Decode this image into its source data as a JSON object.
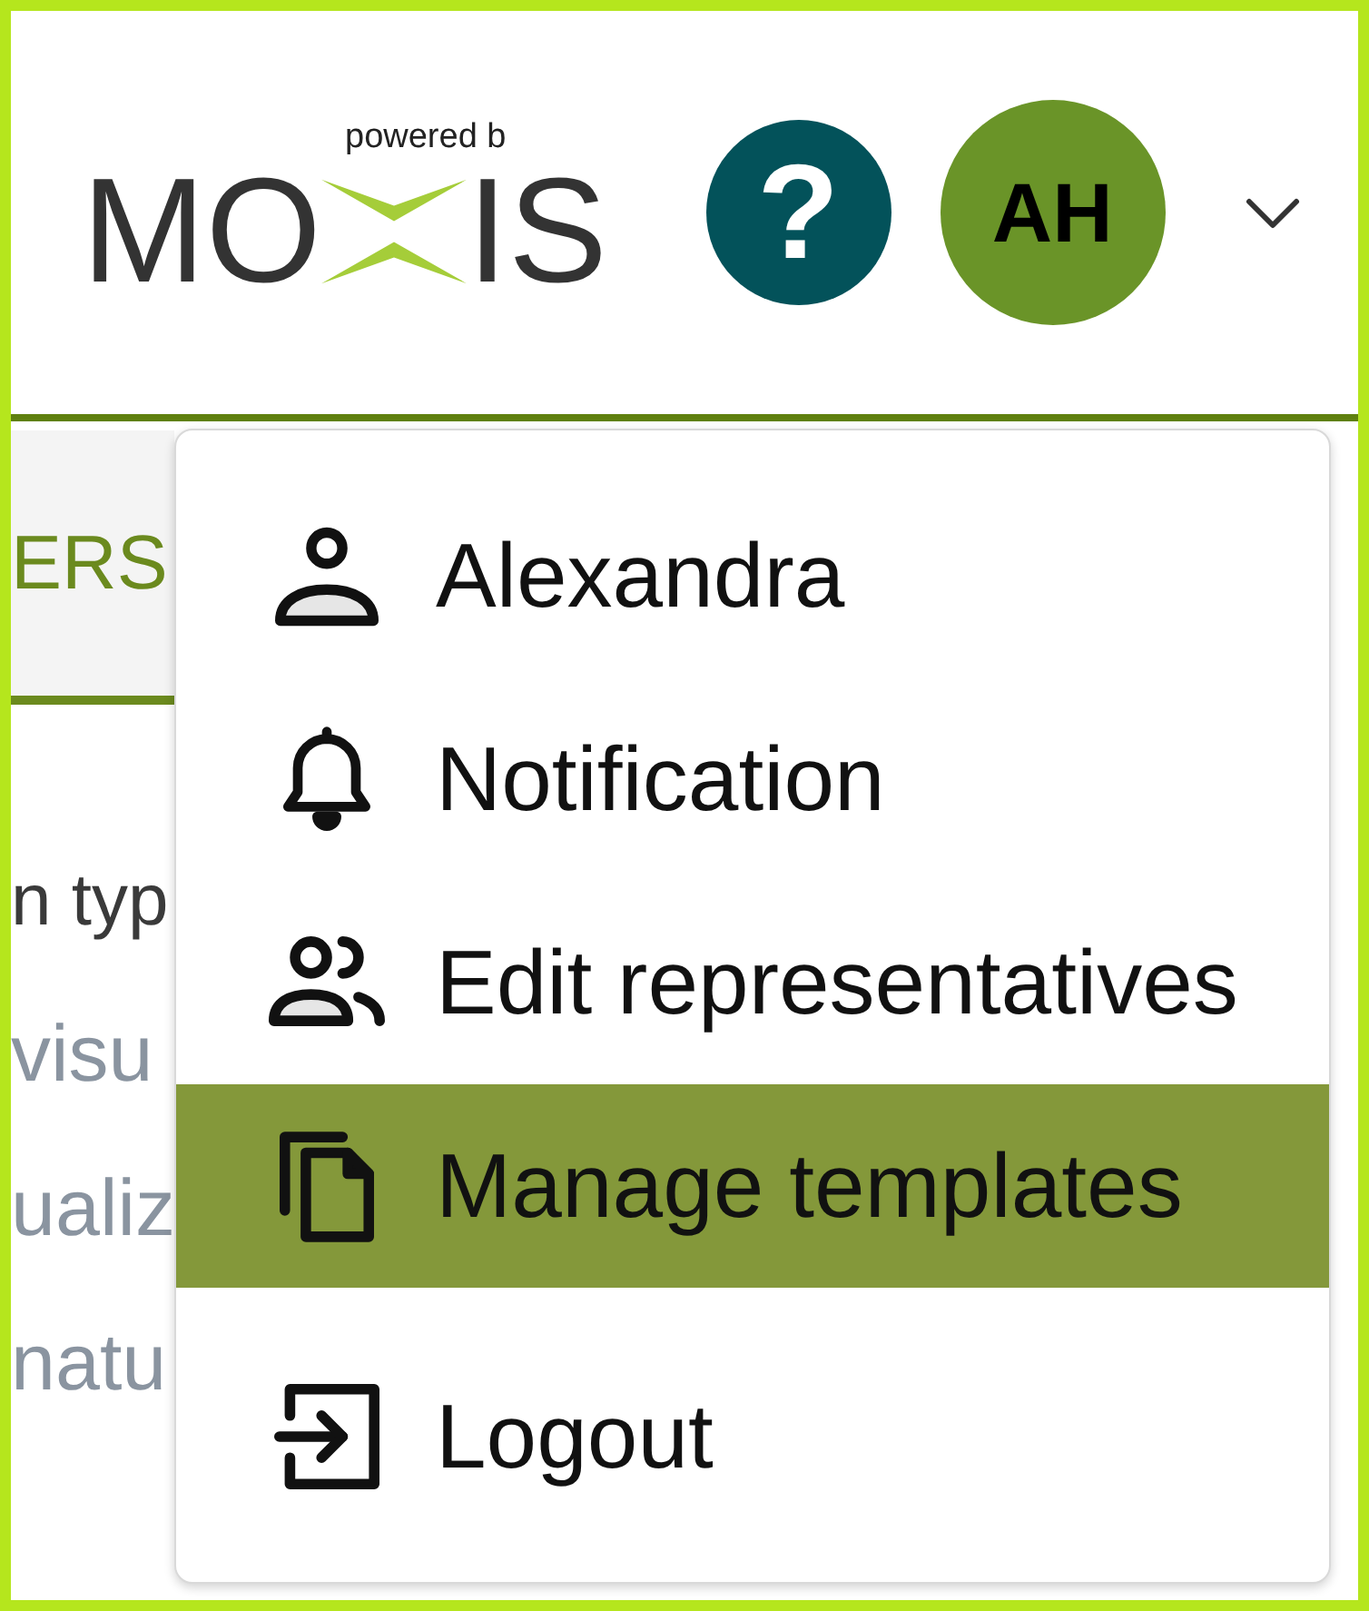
{
  "header": {
    "logo": {
      "tagline": "powered b",
      "wordmark_start": "MO",
      "wordmark_end": "IS"
    },
    "help_button": {
      "label": "?"
    },
    "avatar": {
      "initials": "AH"
    }
  },
  "tabs": [
    {
      "label": "ERS",
      "selected": true
    }
  ],
  "content": {
    "lines": [
      {
        "text": "n typ",
        "kind": "label"
      },
      {
        "text": "visu",
        "kind": "option"
      },
      {
        "text": "ualiz",
        "kind": "option"
      },
      {
        "text": "natu",
        "kind": "option"
      }
    ]
  },
  "user_menu": {
    "sections": [
      {
        "items": [
          {
            "label": "Alexandra",
            "selected": false
          },
          {
            "label": "Notification",
            "selected": false
          },
          {
            "label": "Edit representatives",
            "selected": false
          },
          {
            "label": "Manage templates",
            "selected": true
          }
        ]
      },
      {
        "items": [
          {
            "label": "Logout",
            "selected": false
          }
        ]
      }
    ]
  }
}
